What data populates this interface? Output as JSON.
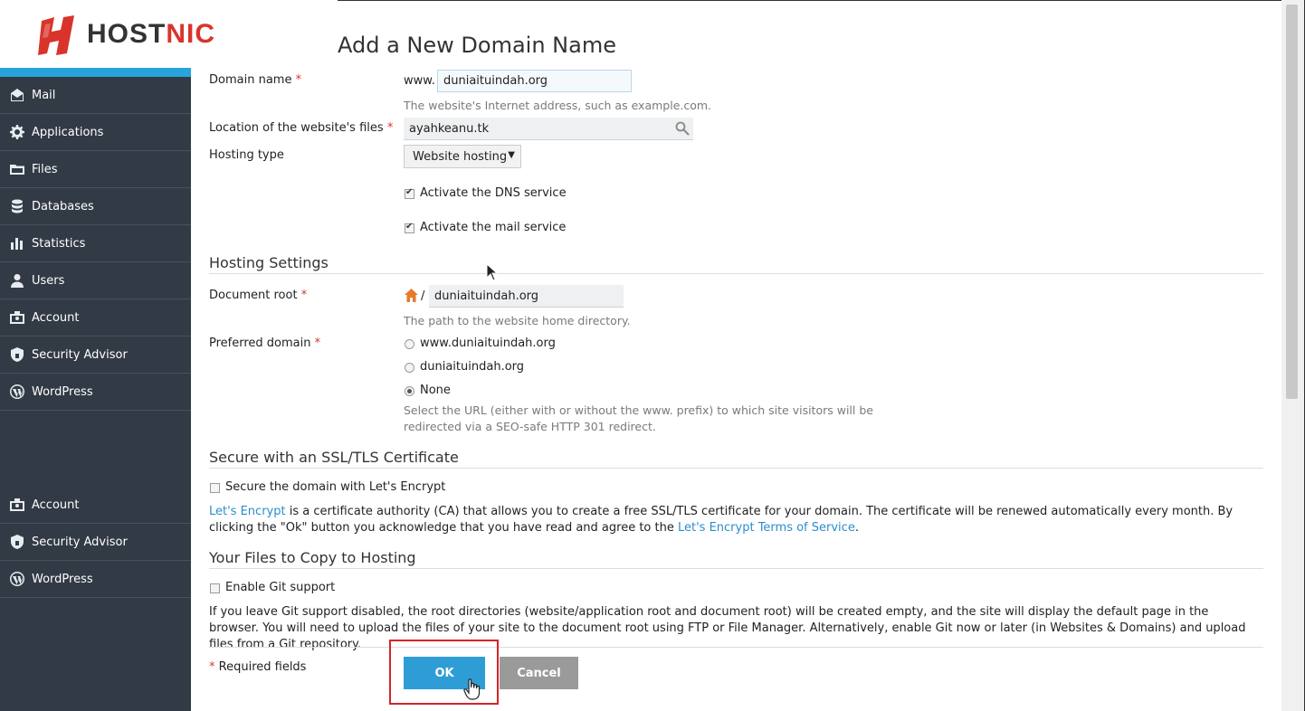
{
  "logo": {
    "text_main": "HOST",
    "text_accent": "NIC"
  },
  "page": {
    "title": "Add a New Domain Name"
  },
  "sidebar": {
    "items": [
      {
        "label": "Mail",
        "icon": "mail-icon"
      },
      {
        "label": "Applications",
        "icon": "gear-icon"
      },
      {
        "label": "Files",
        "icon": "folder-icon"
      },
      {
        "label": "Databases",
        "icon": "database-icon"
      },
      {
        "label": "Statistics",
        "icon": "bar-chart-icon"
      },
      {
        "label": "Users",
        "icon": "user-icon"
      },
      {
        "label": "Account",
        "icon": "account-icon"
      },
      {
        "label": "Security Advisor",
        "icon": "shield-icon"
      },
      {
        "label": "WordPress",
        "icon": "wordpress-icon"
      }
    ],
    "bottom_items": [
      {
        "label": "Account",
        "icon": "account-icon"
      },
      {
        "label": "Security Advisor",
        "icon": "shield-icon"
      },
      {
        "label": "WordPress",
        "icon": "wordpress-icon"
      }
    ]
  },
  "form": {
    "domain_label": "Domain name",
    "domain_prefix": "www.",
    "domain_value": "duniaituindah.org",
    "domain_hint": "The website's Internet address, such as example.com.",
    "location_label": "Location of the website's files",
    "location_value": "ayahkeanu.tk",
    "hosting_type_label": "Hosting type",
    "hosting_type_value": "Website hosting",
    "dns_label": "Activate the DNS service",
    "mail_label": "Activate the mail service",
    "required_marker": "*"
  },
  "hosting_settings": {
    "title": "Hosting Settings",
    "docroot_label": "Document root",
    "docroot_slash": "/",
    "docroot_value": "duniaituindah.org",
    "docroot_hint": "The path to the website home directory.",
    "preferred_label": "Preferred domain",
    "options": [
      "www.duniaituindah.org",
      "duniaituindah.org",
      "None"
    ],
    "selected_option": "None",
    "preferred_hint_1": "Select the URL (either with or without the www. prefix) to which site visitors will be",
    "preferred_hint_2": "redirected via a SEO-safe HTTP 301 redirect."
  },
  "ssl": {
    "title": "Secure with an SSL/TLS Certificate",
    "checkbox_label": "Secure the domain with Let's Encrypt",
    "link1": "Let's Encrypt",
    "text1": " is a certificate authority (CA) that allows you to create a free SSL/TLS certificate for your domain. The certificate will be renewed automatically every month. By clicking the \"Ok\" button you acknowledge that you have read and agree to the ",
    "link2": "Let's Encrypt Terms of Service",
    "text2": "."
  },
  "git": {
    "title": "Your Files to Copy to Hosting",
    "checkbox_label": "Enable Git support",
    "description": "If you leave Git support disabled, the root directories (website/application root and document root) will be created empty, and the site will display the default page in the browser. You will need to upload the files of your site to the document root using FTP or File Manager. Alternatively, enable Git now or later (in Websites & Domains) and upload files from a Git repository."
  },
  "footer": {
    "required_note": "Required fields",
    "ok_label": "OK",
    "cancel_label": "Cancel"
  },
  "colors": {
    "accent": "#2e9dd6",
    "sidebar_bg": "#323a45",
    "required": "#d9342b",
    "highlight": "#d8232a"
  }
}
